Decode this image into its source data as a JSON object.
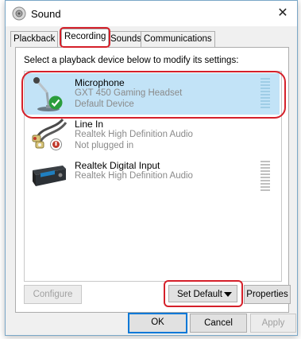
{
  "window": {
    "title": "Sound",
    "close_glyph": "✕"
  },
  "tabs": [
    {
      "label": "Plackback"
    },
    {
      "label": "Recording"
    },
    {
      "label": "Sounds"
    },
    {
      "label": "Communications"
    }
  ],
  "active_tab": "Recording",
  "instruction": "Select a playback device below to modify its settings:",
  "devices": [
    {
      "name": "Microphone",
      "line2": "GXT 450 Gaming Headset",
      "line3": "Default Device",
      "icon": "microphone-icon",
      "status_icon": "default-check-icon",
      "selected": true
    },
    {
      "name": "Line In",
      "line2": "Realtek High Definition Audio",
      "line3": "Not plugged in",
      "icon": "line-in-cable-icon",
      "status_icon": "unplugged-icon",
      "selected": false
    },
    {
      "name": "Realtek Digital Input",
      "line2": "Realtek High Definition Audio",
      "line3": "",
      "icon": "digital-input-device-icon",
      "status_icon": "",
      "selected": false
    }
  ],
  "buttons": {
    "configure": "Configure",
    "set_default": "Set Default",
    "properties": "Properties",
    "ok": "OK",
    "cancel": "Cancel",
    "apply": "Apply"
  },
  "colors": {
    "selection": "#c2e3f7",
    "highlight": "#d5202a",
    "focus": "#0078d7"
  }
}
